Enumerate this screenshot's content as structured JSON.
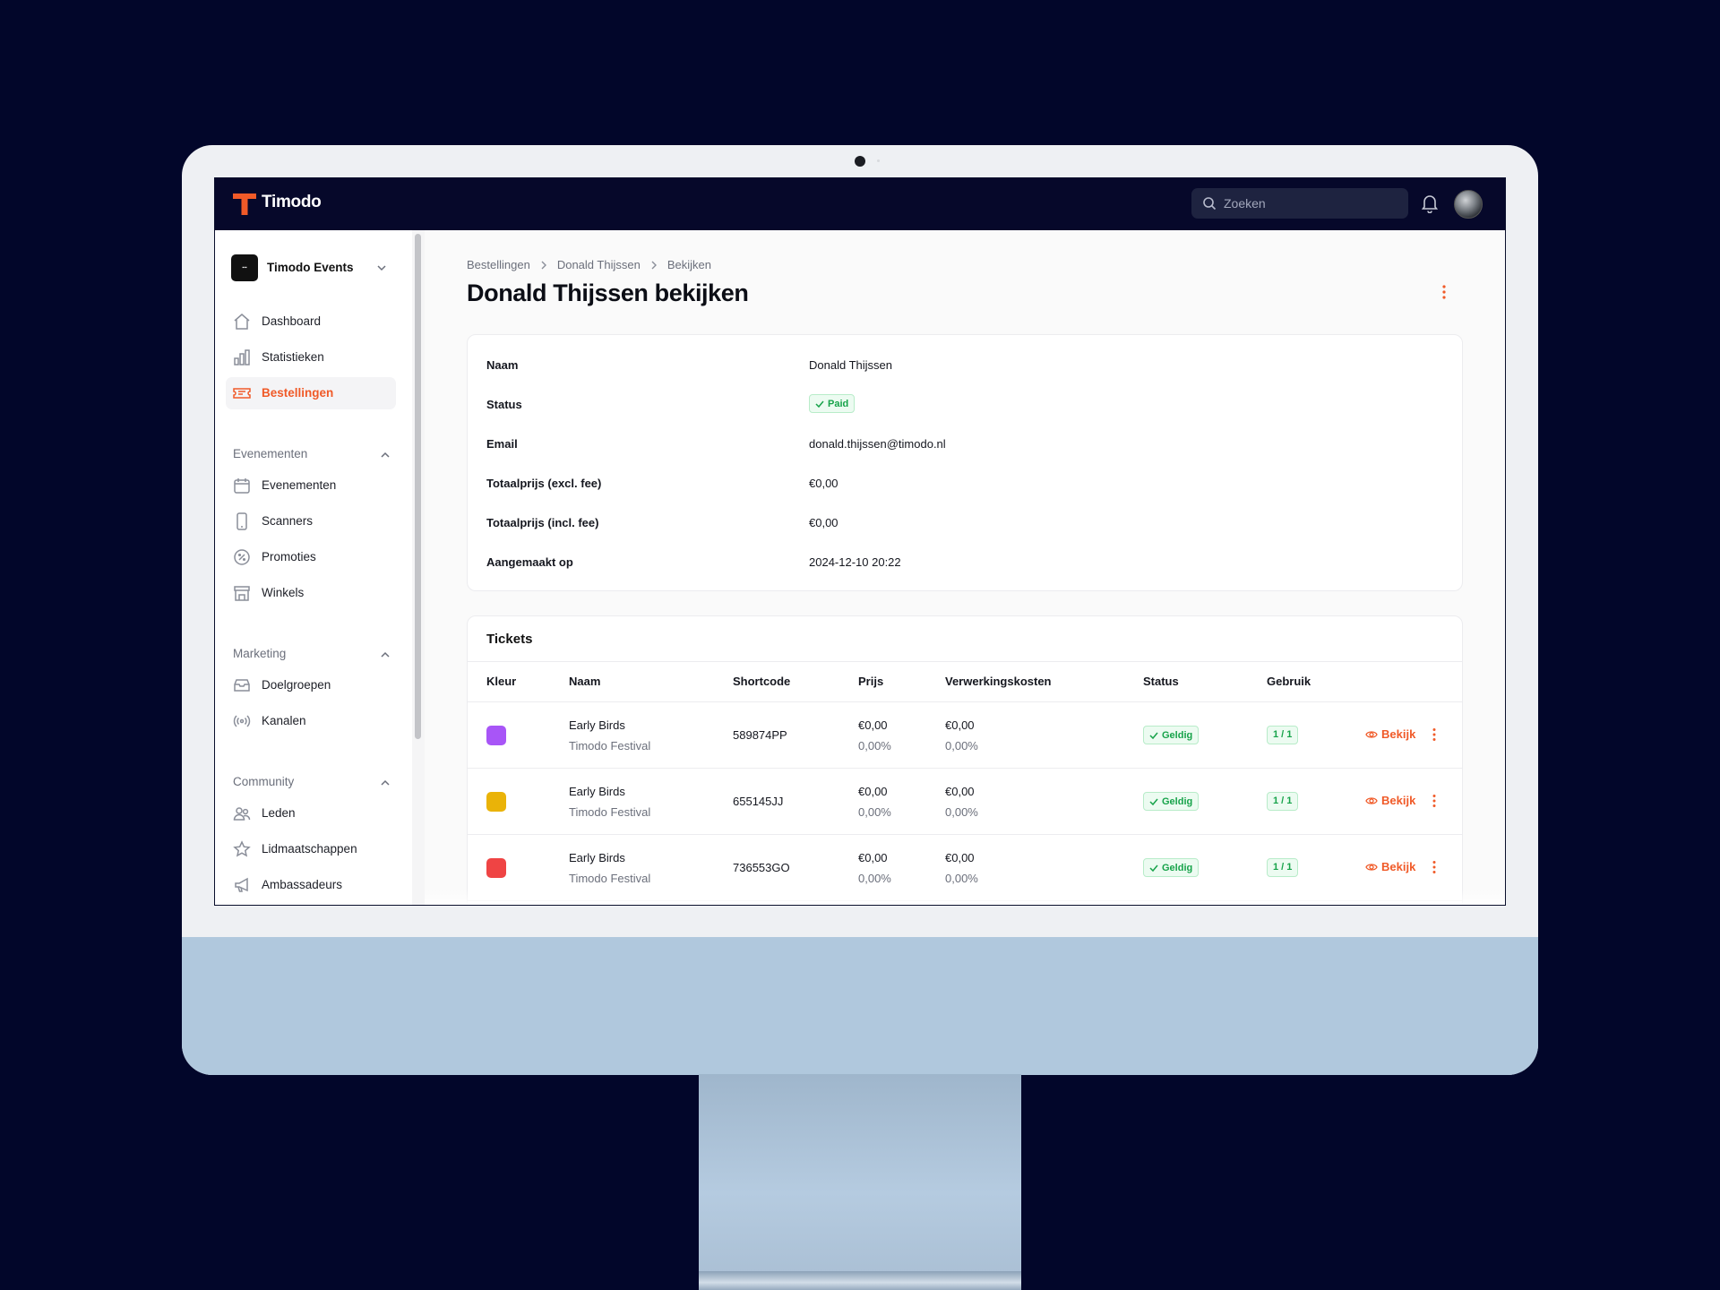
{
  "app": {
    "brand": "Timodo",
    "search_placeholder": "Zoeken",
    "accent_color": "#f05a28",
    "topbar_color": "#06082a"
  },
  "sidebar": {
    "org_name": "Timodo Events",
    "main_items": [
      {
        "label": "Dashboard",
        "icon": "home-icon"
      },
      {
        "label": "Statistieken",
        "icon": "bar-chart-icon"
      },
      {
        "label": "Bestellingen",
        "icon": "ticket-icon",
        "active": true
      }
    ],
    "groups": [
      {
        "title": "Evenementen",
        "items": [
          {
            "label": "Evenementen",
            "icon": "calendar-icon"
          },
          {
            "label": "Scanners",
            "icon": "phone-icon"
          },
          {
            "label": "Promoties",
            "icon": "percent-badge-icon"
          },
          {
            "label": "Winkels",
            "icon": "store-icon"
          }
        ]
      },
      {
        "title": "Marketing",
        "items": [
          {
            "label": "Doelgroepen",
            "icon": "inbox-stack-icon"
          },
          {
            "label": "Kanalen",
            "icon": "signal-icon"
          }
        ]
      },
      {
        "title": "Community",
        "items": [
          {
            "label": "Leden",
            "icon": "users-icon"
          },
          {
            "label": "Lidmaatschappen",
            "icon": "star-icon"
          },
          {
            "label": "Ambassadeurs",
            "icon": "megaphone-icon"
          }
        ]
      }
    ]
  },
  "breadcrumb": [
    "Bestellingen",
    "Donald Thijssen",
    "Bekijken"
  ],
  "page": {
    "title": "Donald Thijssen bekijken"
  },
  "order": {
    "rows": [
      {
        "label": "Naam",
        "value": "Donald Thijssen"
      },
      {
        "label": "Status",
        "value": "Paid",
        "badge": true
      },
      {
        "label": "Email",
        "value": "donald.thijssen@timodo.nl"
      },
      {
        "label": "Totaalprijs (excl. fee)",
        "value": "€0,00"
      },
      {
        "label": "Totaalprijs (incl. fee)",
        "value": "€0,00"
      },
      {
        "label": "Aangemaakt op",
        "value": "2024-12-10 20:22"
      }
    ]
  },
  "tickets": {
    "title": "Tickets",
    "columns": [
      "Kleur",
      "Naam",
      "Shortcode",
      "Prijs",
      "Verwerkingskosten",
      "Status",
      "Gebruik"
    ],
    "view_label": "Bekijk",
    "rows": [
      {
        "color": "#a855f7",
        "name": "Early Birds",
        "event": "Timodo Festival",
        "shortcode": "589874PP",
        "price": "€0,00",
        "price_pct": "0,00%",
        "fee": "€0,00",
        "fee_pct": "0,00%",
        "status": "Geldig",
        "usage": "1 / 1"
      },
      {
        "color": "#eab308",
        "name": "Early Birds",
        "event": "Timodo Festival",
        "shortcode": "655145JJ",
        "price": "€0,00",
        "price_pct": "0,00%",
        "fee": "€0,00",
        "fee_pct": "0,00%",
        "status": "Geldig",
        "usage": "1 / 1"
      },
      {
        "color": "#ef4444",
        "name": "Early Birds",
        "event": "Timodo Festival",
        "shortcode": "736553GO",
        "price": "€0,00",
        "price_pct": "0,00%",
        "fee": "€0,00",
        "fee_pct": "0,00%",
        "status": "Geldig",
        "usage": "1 / 1"
      }
    ]
  }
}
